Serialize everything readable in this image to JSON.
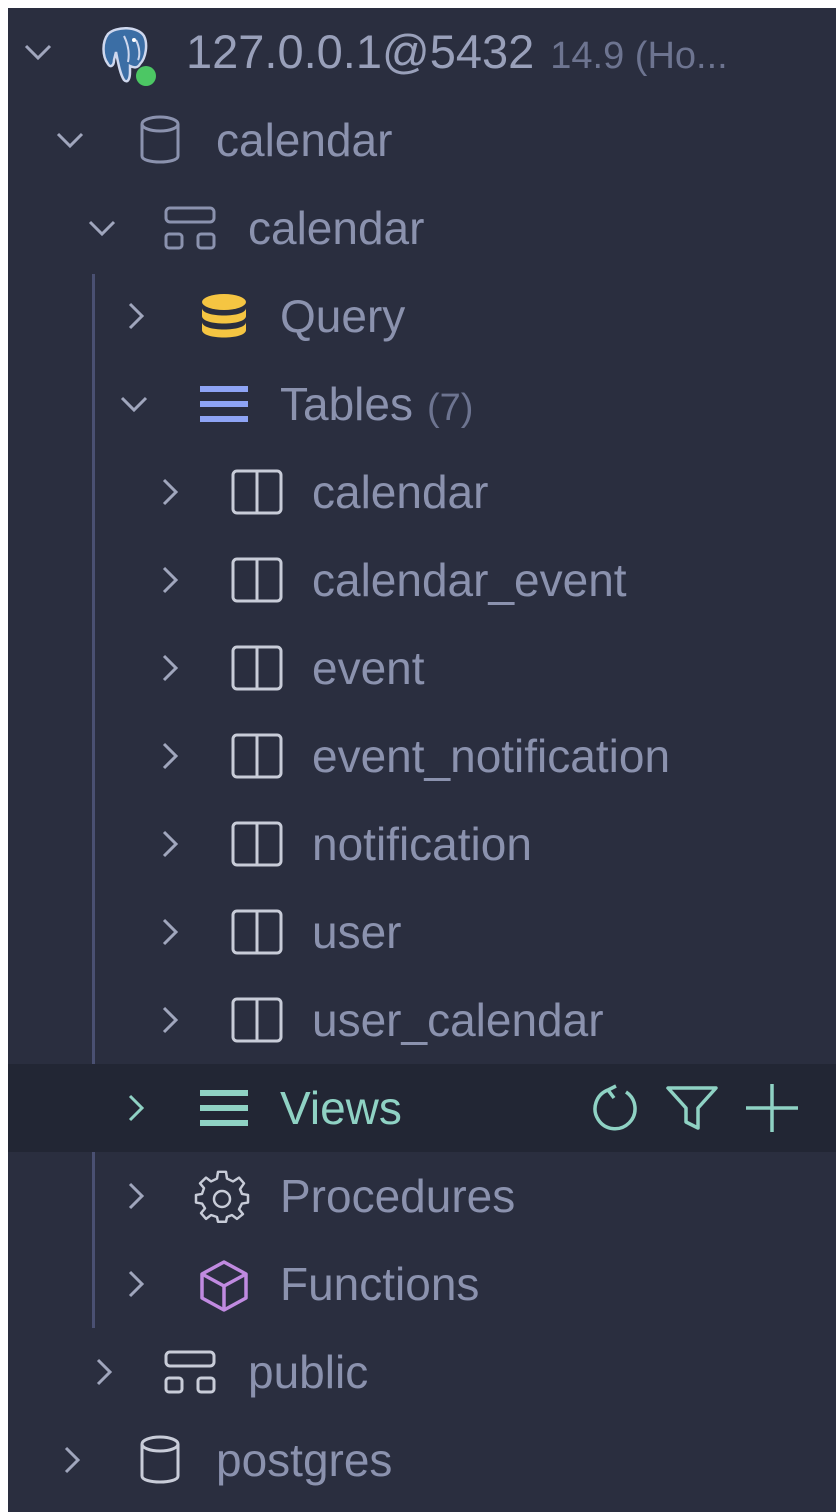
{
  "connection": {
    "label": "127.0.0.1@5432",
    "version": "14.9 (Ho...",
    "icon": "postgres-elephant-icon",
    "status_color": "#4cc764"
  },
  "databases": [
    {
      "name": "calendar",
      "icon": "database-icon",
      "schemas": [
        {
          "name": "calendar",
          "icon": "schema-icon",
          "groups": {
            "query": {
              "label": "Query",
              "icon": "query-stack-icon"
            },
            "tables": {
              "label": "Tables",
              "count": "(7)",
              "icon": "tables-list-icon",
              "items": [
                "calendar",
                "calendar_event",
                "event",
                "event_notification",
                "notification",
                "user",
                "user_calendar"
              ]
            },
            "views": {
              "label": "Views",
              "icon": "views-list-icon",
              "actions": [
                "refresh-icon",
                "filter-icon",
                "add-icon"
              ]
            },
            "procedures": {
              "label": "Procedures",
              "icon": "gear-icon"
            },
            "functions": {
              "label": "Functions",
              "icon": "cube-icon"
            }
          }
        },
        {
          "name": "public",
          "icon": "schema-icon"
        }
      ]
    },
    {
      "name": "postgres",
      "icon": "database-icon"
    }
  ],
  "colors": {
    "background": "#2a2e3f",
    "selected_row": "#222634",
    "text": "#8b92ae",
    "views_accent": "#8fd2c4",
    "query_icon": "#f5c542",
    "tables_icon": "#8ea4f5",
    "functions_icon": "#c08ae0",
    "tree_line": "#4a5072"
  }
}
